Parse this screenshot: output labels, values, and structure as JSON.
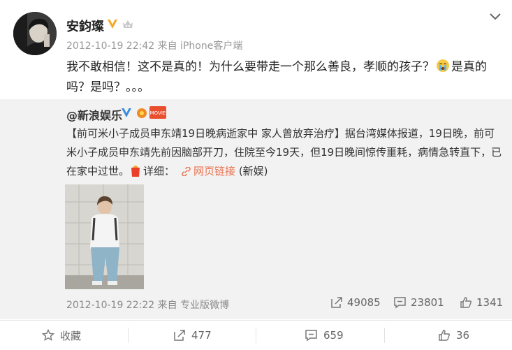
{
  "post": {
    "author": "安鈞璨",
    "time_source": "2012-10-19 22:42 来自 iPhone客户端",
    "text_part1": "我不敢相信！这不是真的！为什么要带走一个那么善良，孝顺的孩子？",
    "text_part2": "是真的吗？是吗？。。。"
  },
  "repost": {
    "author": "@新浪娱乐",
    "badge_text": "MOVIE",
    "text": "【前可米小子成员申东靖19日晚病逝家中 家人曾放弃治疗】据台湾媒体报道，19日晚，前可米小子成员申东靖先前因脑部开刀，住院至今19天，但19日晚间惊传噩耗，病情急转直下，已在家中过世。",
    "detail_label": "详细：",
    "link_label": "网页链接",
    "source_note": "(新娱)",
    "time_source": "2012-10-19 22:22 来自 专业版微博",
    "reposts": "49085",
    "comments": "23801",
    "likes": "1341"
  },
  "actions": {
    "favorite": "收藏",
    "reposts": "477",
    "comments": "659",
    "likes": "36"
  },
  "colors": {
    "link": "#eb7350",
    "vip_badge": "#f5a623",
    "repost_bg": "#f2f2f2"
  }
}
